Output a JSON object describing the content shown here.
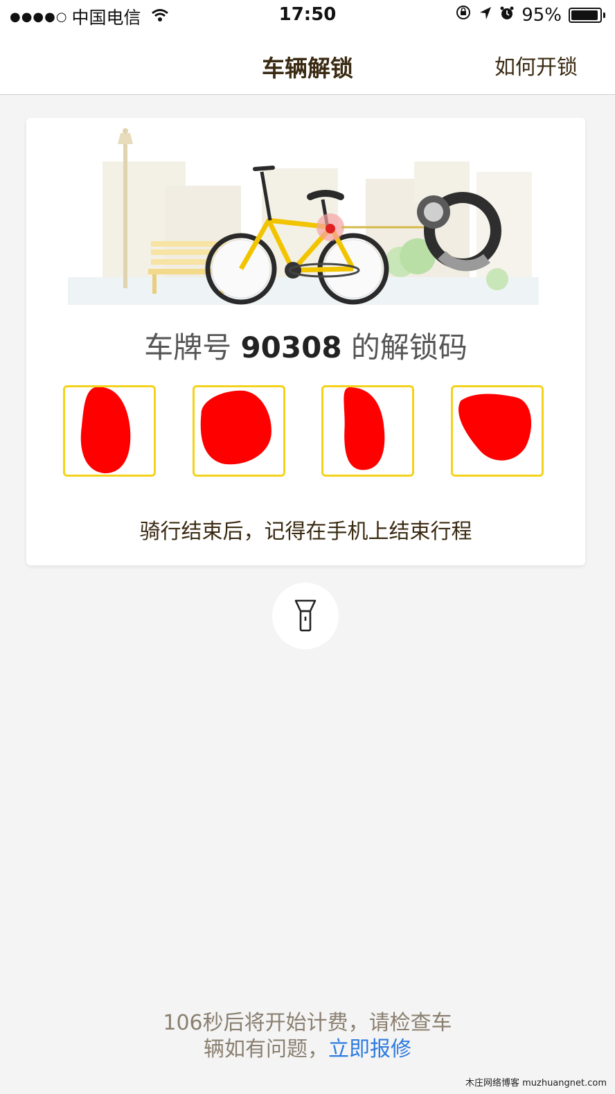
{
  "status_bar": {
    "signal": "●●●●○",
    "carrier": "中国电信",
    "time": "17:50",
    "battery": "95%",
    "battery_level": 0.95
  },
  "nav": {
    "title": "车辆解锁",
    "help_label": "如何开锁"
  },
  "card": {
    "plate_prefix": "车牌号",
    "plate_number": "90308",
    "plate_suffix": "的解锁码",
    "code_digits": [
      "",
      "",
      "",
      ""
    ],
    "reminder": "骑行结束后，记得在手机上结束行程"
  },
  "icons": {
    "flashlight": "flashlight-icon"
  },
  "notice": {
    "line1": "106秒后将开始计费，请检查车",
    "line2_prefix": "辆如有问题，",
    "repair_link": "立即报修"
  },
  "watermark": "木庄网络博客 muzhuangnet.com",
  "colors": {
    "accent_yellow": "#f5d21a",
    "link_blue": "#2d7be0",
    "title_brown": "#3a2a12",
    "redaction_red": "#ff0000"
  }
}
